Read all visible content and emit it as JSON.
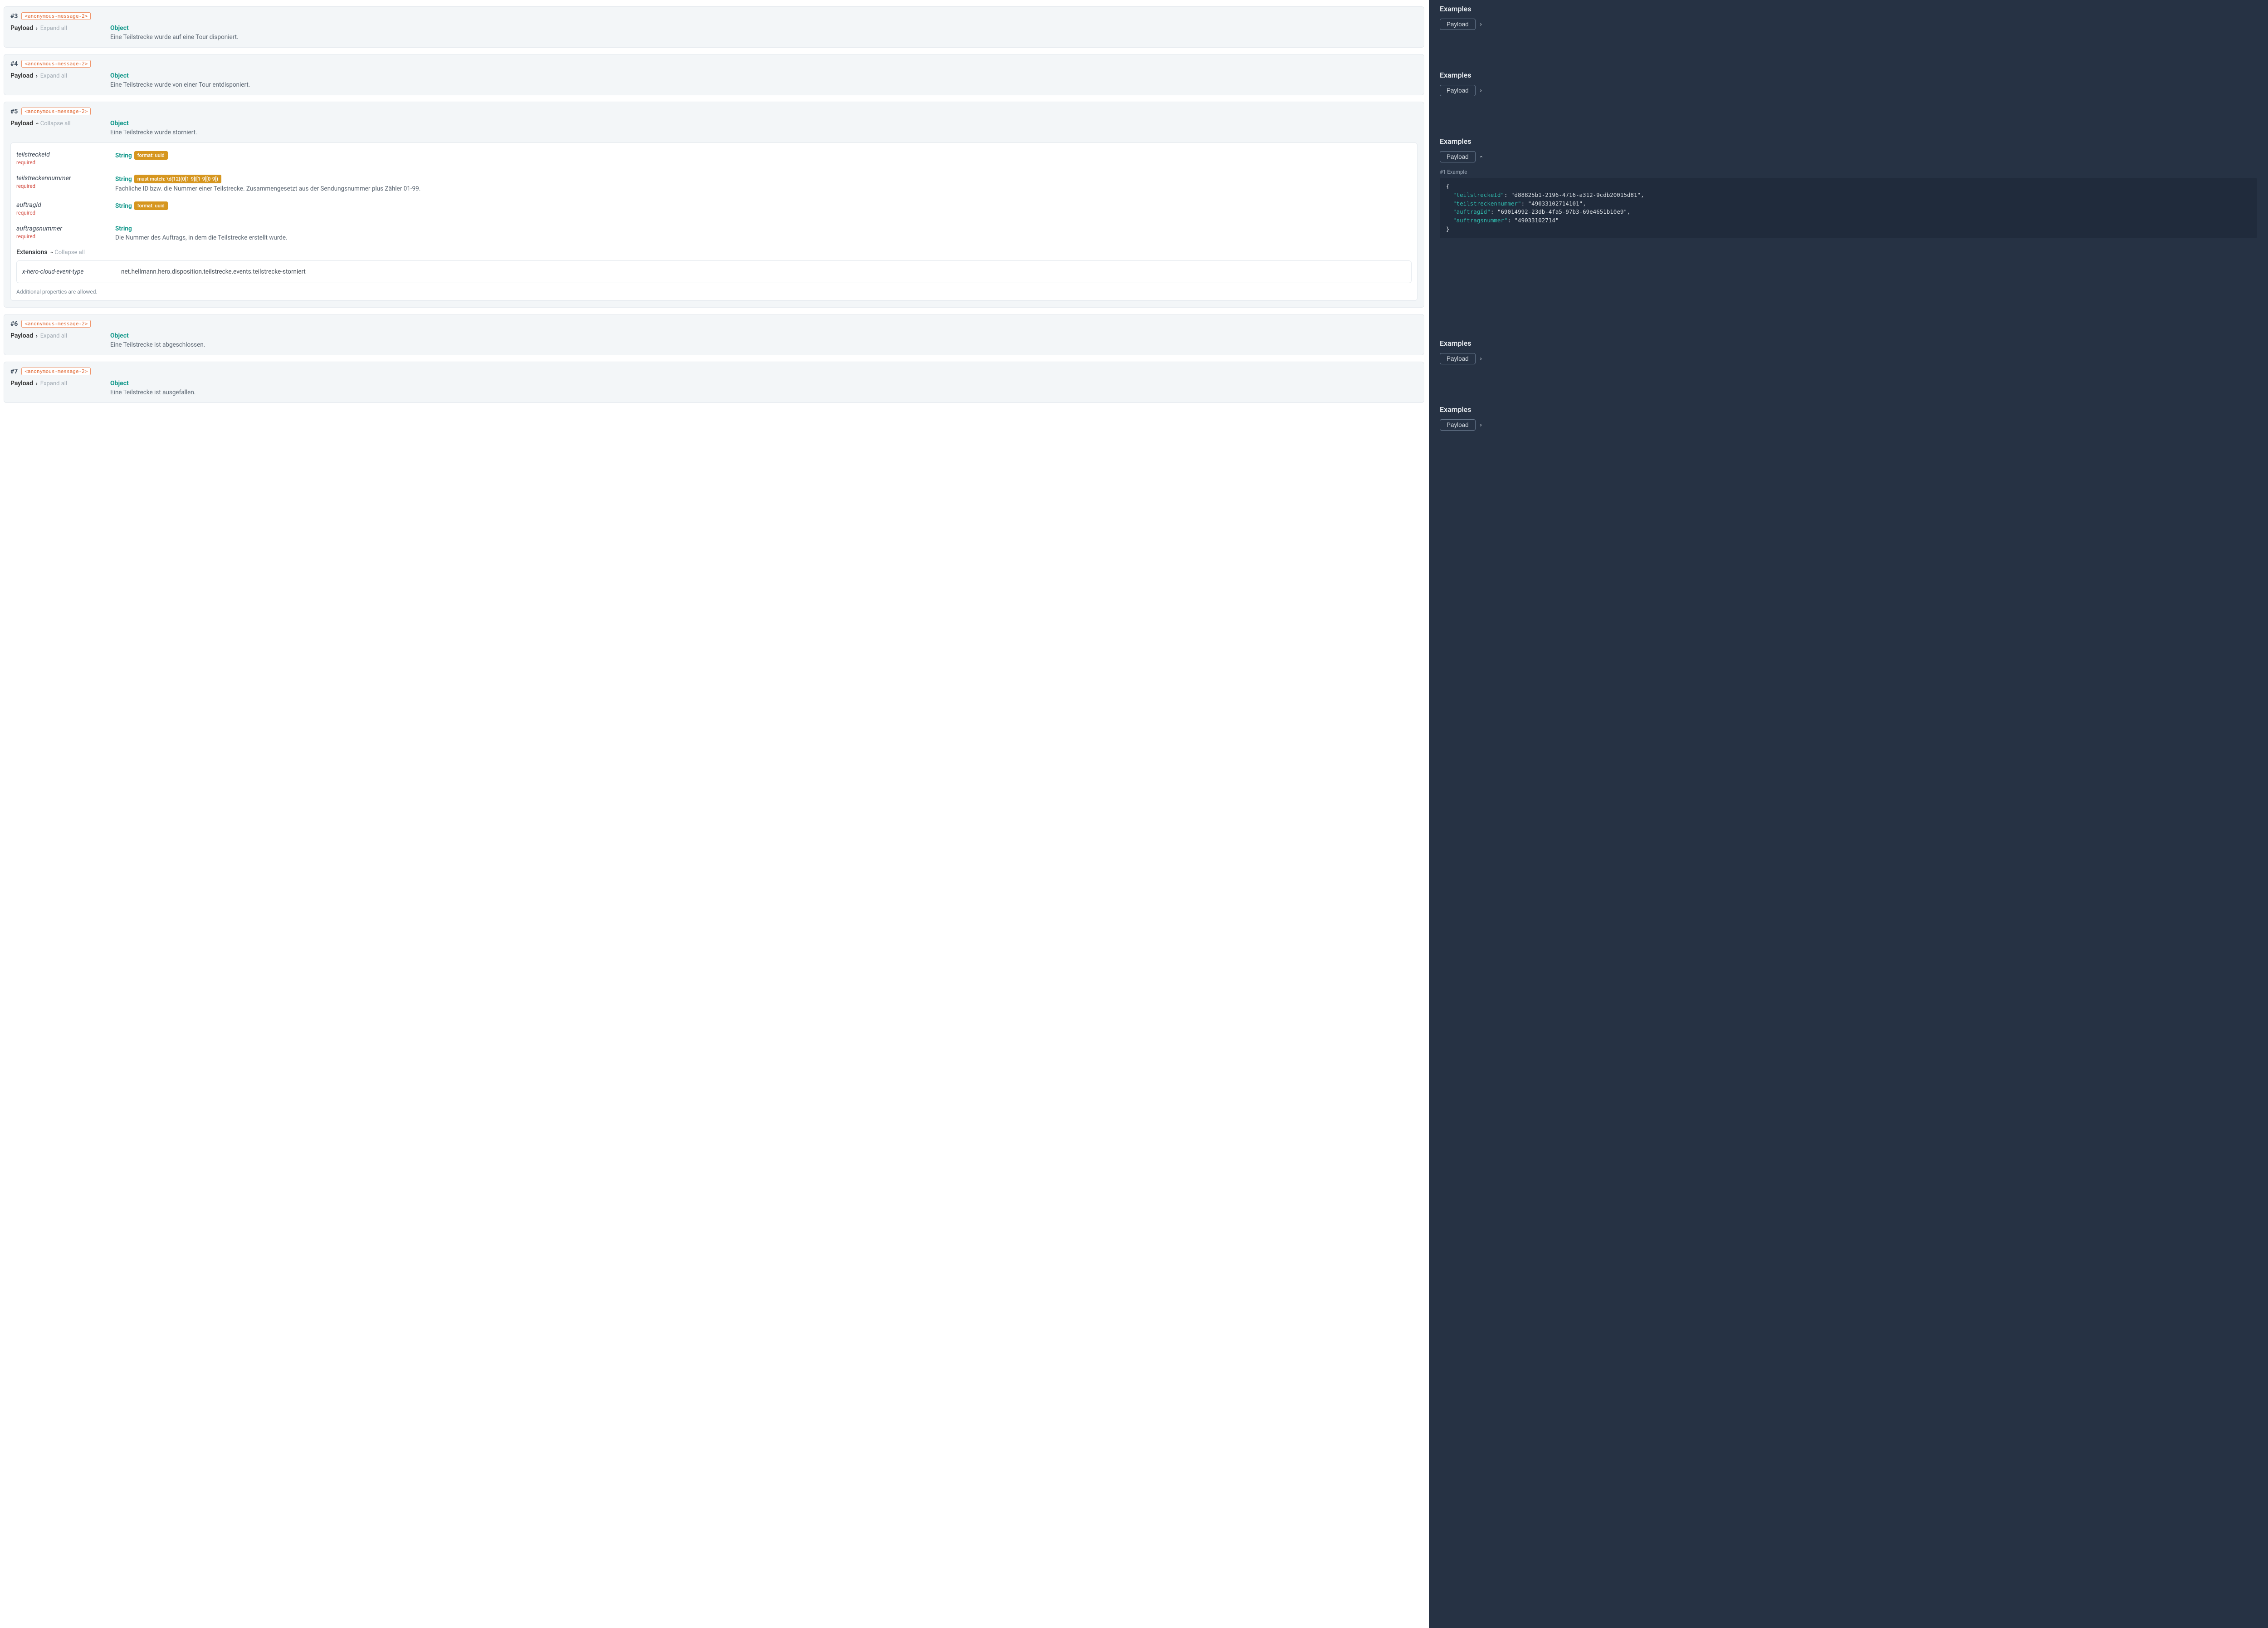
{
  "tag_text": "<anonymous-message-2>",
  "labels": {
    "payload": "Payload",
    "expand_all": "Expand all",
    "collapse_all": "Collapse all",
    "object": "Object",
    "extensions": "Extensions",
    "required": "required",
    "addl": "Additional properties are allowed.",
    "examples": "Examples",
    "example1": "#1 Example"
  },
  "messages": [
    {
      "num": "#3",
      "desc": "Eine Teilstrecke wurde auf eine Tour disponiert.",
      "expanded": false
    },
    {
      "num": "#4",
      "desc": "Eine Teilstrecke wurde von einer Tour entdisponiert.",
      "expanded": false
    },
    {
      "num": "#5",
      "desc": "Eine Teilstrecke wurde storniert.",
      "expanded": true
    },
    {
      "num": "#6",
      "desc": "Eine Teilstrecke ist abgeschlossen.",
      "expanded": false
    },
    {
      "num": "#7",
      "desc": "Eine Teilstrecke ist ausgefallen.",
      "expanded": false
    }
  ],
  "msg5_props": [
    {
      "name": "teilstreckeId",
      "required": true,
      "type": "String",
      "badges": [
        "format: uuid"
      ],
      "desc": ""
    },
    {
      "name": "teilstreckennummer",
      "required": true,
      "type": "String",
      "badges": [
        "must match: \\d{12}(0[1-9]|[1-9][0-9])"
      ],
      "desc": "Fachliche ID bzw. die Nummer einer Teilstrecke. Zusammengesetzt aus der Sendungsnummer plus Zähler 01-99."
    },
    {
      "name": "auftragId",
      "required": true,
      "type": "String",
      "badges": [
        "format: uuid"
      ],
      "desc": ""
    },
    {
      "name": "auftragsnummer",
      "required": true,
      "type": "String",
      "badges": [],
      "desc": "Die Nummer des Auftrags, in dem die Teilstrecke erstellt wurde."
    }
  ],
  "msg5_ext": {
    "key": "x-hero-cloud-event-type",
    "val": "net.hellmann.hero.disposition.teilstrecke.events.teilstrecke-storniert"
  },
  "example_json": {
    "teilstreckeId": "d88825b1-2196-4716-a312-9cdb20015d81",
    "teilstreckennummer": "49033102714101",
    "auftragId": "69014992-23db-4fa5-97b3-69e4651b10e9",
    "auftragsnummer": "49033102714"
  },
  "side_sections": [
    {
      "expanded": false
    },
    {
      "expanded": false
    },
    {
      "expanded": true
    },
    {
      "expanded": false
    },
    {
      "expanded": false
    }
  ]
}
